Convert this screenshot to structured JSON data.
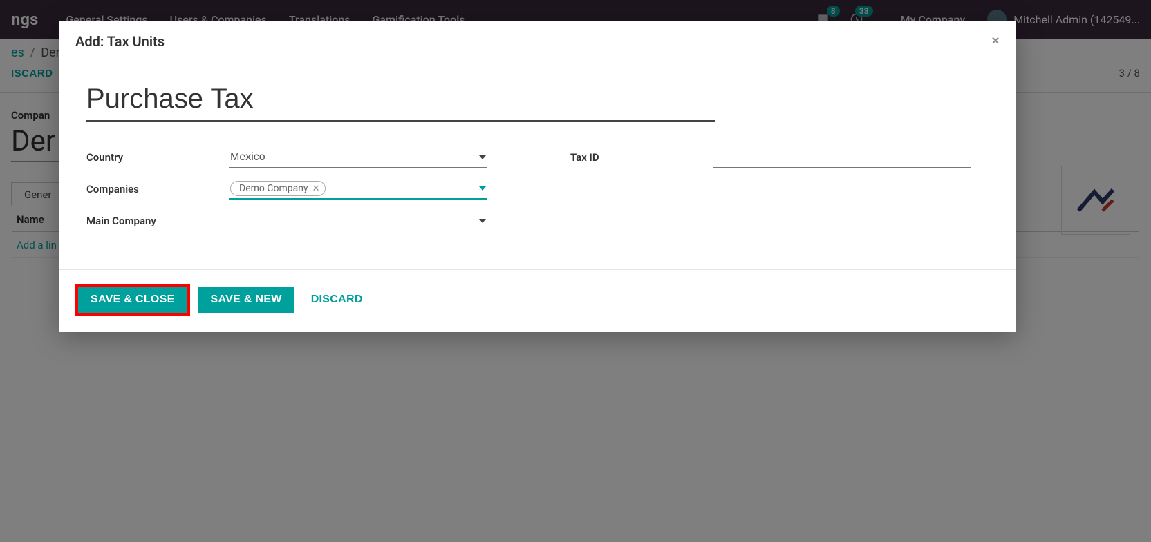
{
  "navbar": {
    "brand": "ngs",
    "items": [
      "General Settings",
      "Users & Companies",
      "Translations",
      "Gamification Tools"
    ],
    "badges": {
      "messages": "8",
      "activities": "33"
    },
    "company": "My Company",
    "user": "Mitchell Admin (142549..."
  },
  "breadcrumb": {
    "parent": "es",
    "current": "Den"
  },
  "toolbar": {
    "discard": "ISCARD"
  },
  "pager": "3 / 8",
  "background": {
    "company_label": "Compan",
    "company_name": "Der",
    "tab": "Gener",
    "col_name": "Name",
    "add_line": "Add a lin"
  },
  "modal": {
    "title": "Add: Tax Units",
    "name_value": "Purchase Tax",
    "fields": {
      "country": {
        "label": "Country",
        "value": "Mexico"
      },
      "companies": {
        "label": "Companies",
        "tag": "Demo Company"
      },
      "main_company": {
        "label": "Main Company",
        "value": ""
      },
      "tax_id": {
        "label": "Tax ID",
        "value": ""
      }
    },
    "buttons": {
      "save_close": "SAVE & CLOSE",
      "save_new": "SAVE & NEW",
      "discard": "DISCARD"
    }
  }
}
